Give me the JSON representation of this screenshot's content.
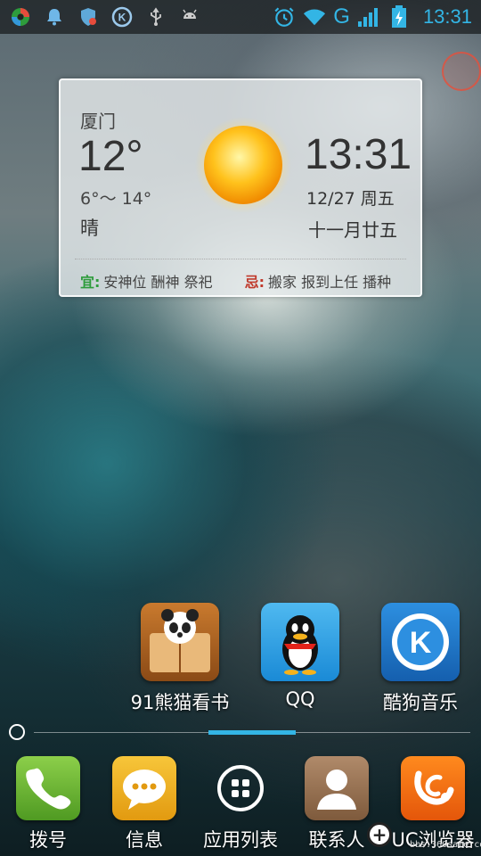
{
  "status_bar": {
    "left_icons": [
      "app-store-icon",
      "notification-bell-icon",
      "security-shield-icon",
      "kugou-icon",
      "usb-icon",
      "android-debug-icon"
    ],
    "right_icons": [
      "alarm-clock-icon",
      "wifi-icon",
      "network-g-icon",
      "signal-icon",
      "battery-charging-icon"
    ],
    "network_type": "G",
    "time": "13:31"
  },
  "weather_widget": {
    "city": "厦门",
    "temperature": "12°",
    "range": "6°～ 14°",
    "condition": "晴",
    "condition_icon": "sunny-icon",
    "clock": "13:31",
    "date": "12/27 周五",
    "lunar_date": "十一月廿五",
    "almanac": {
      "yi_label": "宜:",
      "yi_text": "安神位 酬神 祭祀",
      "ji_label": "忌:",
      "ji_text": "搬家 报到上任 播种"
    }
  },
  "home_apps": [
    {
      "label": "91熊猫看书",
      "icon": "panda-reader-icon"
    },
    {
      "label": "QQ",
      "icon": "qq-penguin-icon"
    },
    {
      "label": "酷狗音乐",
      "icon": "kugou-music-icon"
    }
  ],
  "dock": [
    {
      "label": "拨号",
      "icon": "phone-icon"
    },
    {
      "label": "信息",
      "icon": "message-icon"
    },
    {
      "label": "应用列表",
      "icon": "app-drawer-icon"
    },
    {
      "label": "联系人",
      "icon": "contacts-icon"
    },
    {
      "label": "UC浏览器",
      "icon": "uc-browser-icon"
    }
  ],
  "watermark": {
    "url": "bbs.360safe.com"
  },
  "colors": {
    "accent": "#33b5e5",
    "yi": "#2e9c3c",
    "ji": "#c0392b"
  }
}
